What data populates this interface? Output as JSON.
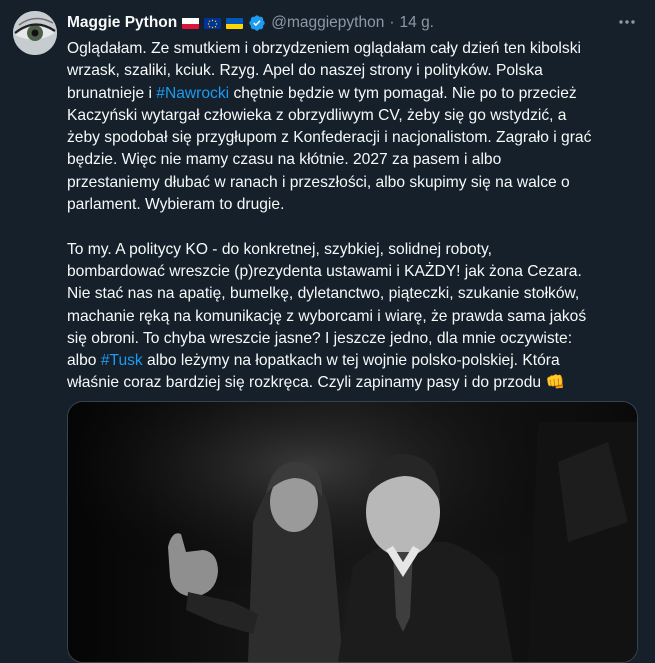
{
  "author": {
    "name": "Maggie Python",
    "handle": "@maggiepython",
    "separator": "·",
    "time": "14 g.",
    "flags": [
      "poland-flag-icon",
      "eu-flag-icon",
      "ukraine-flag-icon"
    ],
    "verified_icon": "verified-badge-icon"
  },
  "more_icon": "more-options-icon",
  "tweet": {
    "paragraph1": [
      "Oglądałam. Ze smutkiem i obrzydzeniem oglądałam cały dzień ten kibolski",
      "wrzask, szaliki, kciuk. Rzyg. Apel do naszej strony i polityków. Polska",
      "chętnie będzie w tym pomagał. Nie po to przecież",
      "Kaczyński wytargał człowieka z obrzydliwym CV, żeby się go wstydzić, a",
      "żeby spodobał się przygłupom z Konfederacji i nacjonalistom. Zagrało i grać",
      "będzie. Więc nie mamy czasu na kłótnie. 2027 za pasem i albo",
      "przestaniemy dłubać w ranach i przeszłości, albo skupimy się na walce o",
      "parlament. Wybieram to drugie."
    ],
    "p1_line3_prefix": "brunatnieje i ",
    "hashtag1": "#Nawrocki",
    "paragraph2": [
      "To my. A politycy KO - do konkretnej, szybkiej, solidnej roboty,",
      "bombardować wreszcie (p)rezydenta ustawami i KAŻDY! jak żona Cezara.",
      "Nie stać nas na apatię, bumelkę, dyletanctwo, piąteczki, szukanie stołków,",
      "machanie ręką na komunikację z wyborcami i wiarę, że prawda sama jakoś",
      "się obroni. To chyba wreszcie jasne? I jeszcze jedno, dla mnie oczywiste:",
      " albo leżymy na łopatkach w tej wojnie polsko-polskiej. Która",
      "właśnie coraz bardziej się rozkręca. Czyli zapinamy pasy i do przodu"
    ],
    "p2_line6_prefix": "albo ",
    "hashtag2": "#Tusk",
    "emoji": "👊"
  },
  "media": {
    "kind": "photo",
    "style": "black-and-white",
    "subject_icon": "photo-man-thumbs-up"
  }
}
